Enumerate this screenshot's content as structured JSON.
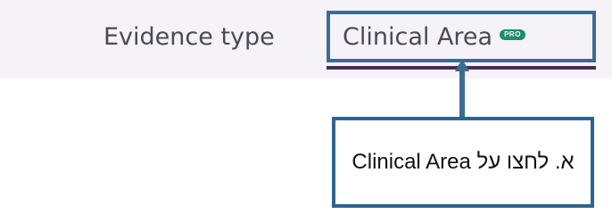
{
  "tabs": [
    {
      "label": "Evidence type"
    },
    {
      "label": "Clinical Area",
      "badge": "PRO"
    }
  ],
  "callout": {
    "text": "א. לחצו על Clinical Area"
  },
  "colors": {
    "tab_bar_background": "#f6f3f8",
    "highlight_border": "#3b6c93",
    "active_underline": "#4a2d55",
    "pro_badge": "#1e8c6f"
  }
}
